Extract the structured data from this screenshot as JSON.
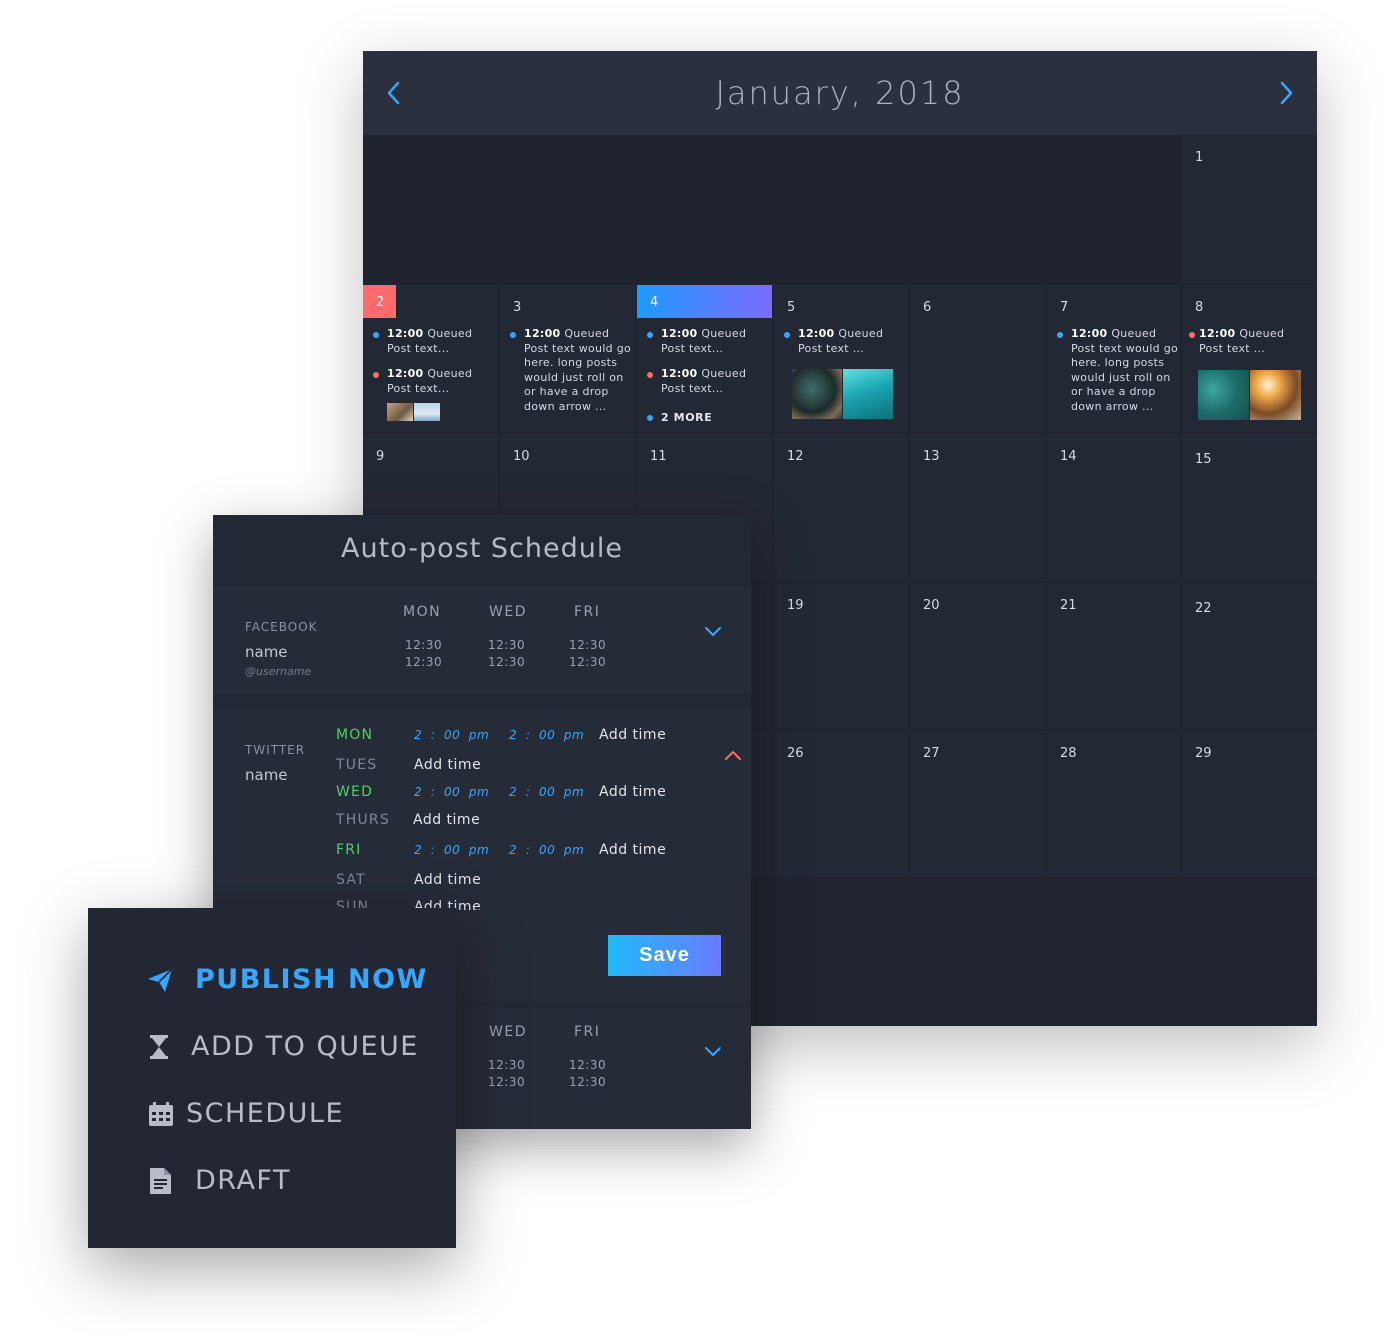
{
  "calendar": {
    "title": "January, 2018",
    "weeks": [
      {
        "days": [
          {
            "num": "1"
          }
        ]
      },
      {
        "days": [
          {
            "num": "2"
          },
          {
            "num": "3"
          },
          {
            "num": "4"
          },
          {
            "num": "5"
          },
          {
            "num": "6"
          },
          {
            "num": "7"
          },
          {
            "num": "8"
          }
        ]
      },
      {
        "days": [
          {
            "num": "9"
          },
          {
            "num": "10"
          },
          {
            "num": "11"
          },
          {
            "num": "12"
          },
          {
            "num": "13"
          },
          {
            "num": "14"
          },
          {
            "num": "15"
          }
        ]
      },
      {
        "days": [
          {
            "num": "19"
          },
          {
            "num": "20"
          },
          {
            "num": "21"
          },
          {
            "num": "22"
          }
        ]
      },
      {
        "days": [
          {
            "num": "26"
          },
          {
            "num": "27"
          },
          {
            "num": "28"
          },
          {
            "num": "29"
          }
        ]
      }
    ],
    "posts": {
      "queued_time": "12:00",
      "queued_label": "Queued",
      "short_text": "Post text...",
      "short_text_spaced": "Post text ...",
      "long_text": "Post text would go here. long posts would just roll on or have a drop down arrow ...",
      "more": "2 MORE"
    },
    "colors": {
      "today_gradient_start": "#1e9bff",
      "today_gradient_end": "#7b6bff",
      "past_day": "#ff6b6b",
      "dot_blue": "#36a7ff",
      "dot_red": "#ff6b6b"
    }
  },
  "schedule": {
    "title": "Auto-post Schedule",
    "facebook": {
      "network": "FACEBOOK",
      "name": "name",
      "username": "@username",
      "days": [
        "MON",
        "WED",
        "FRI"
      ],
      "times": [
        "12:30",
        "12:30"
      ]
    },
    "twitter": {
      "network": "TWITTER",
      "name": "name",
      "rows": [
        {
          "day": "MON",
          "active": true
        },
        {
          "day": "TUES",
          "active": false
        },
        {
          "day": "WED",
          "active": true
        },
        {
          "day": "THURS",
          "active": false
        },
        {
          "day": "FRI",
          "active": true
        },
        {
          "day": "SAT",
          "active": false
        },
        {
          "day": "SUN",
          "active": false
        }
      ],
      "slot": {
        "hour": "2",
        "sep": ":",
        "min": "00",
        "ampm": "pm"
      },
      "add_time": "Add time"
    },
    "save_label": "Save",
    "bottom": {
      "days": [
        "WED",
        "FRI"
      ],
      "times": [
        "12:30",
        "12:30"
      ]
    }
  },
  "menu": {
    "items": [
      {
        "label": "PUBLISH NOW",
        "icon": "paper-plane-icon",
        "active": true
      },
      {
        "label": "ADD TO QUEUE",
        "icon": "hourglass-icon",
        "active": false
      },
      {
        "label": "SCHEDULE",
        "icon": "calendar-icon",
        "active": false
      },
      {
        "label": "DRAFT",
        "icon": "document-icon",
        "active": false
      }
    ],
    "colors": {
      "active": "#36a7ff",
      "inactive": "#b7bcc8"
    }
  }
}
